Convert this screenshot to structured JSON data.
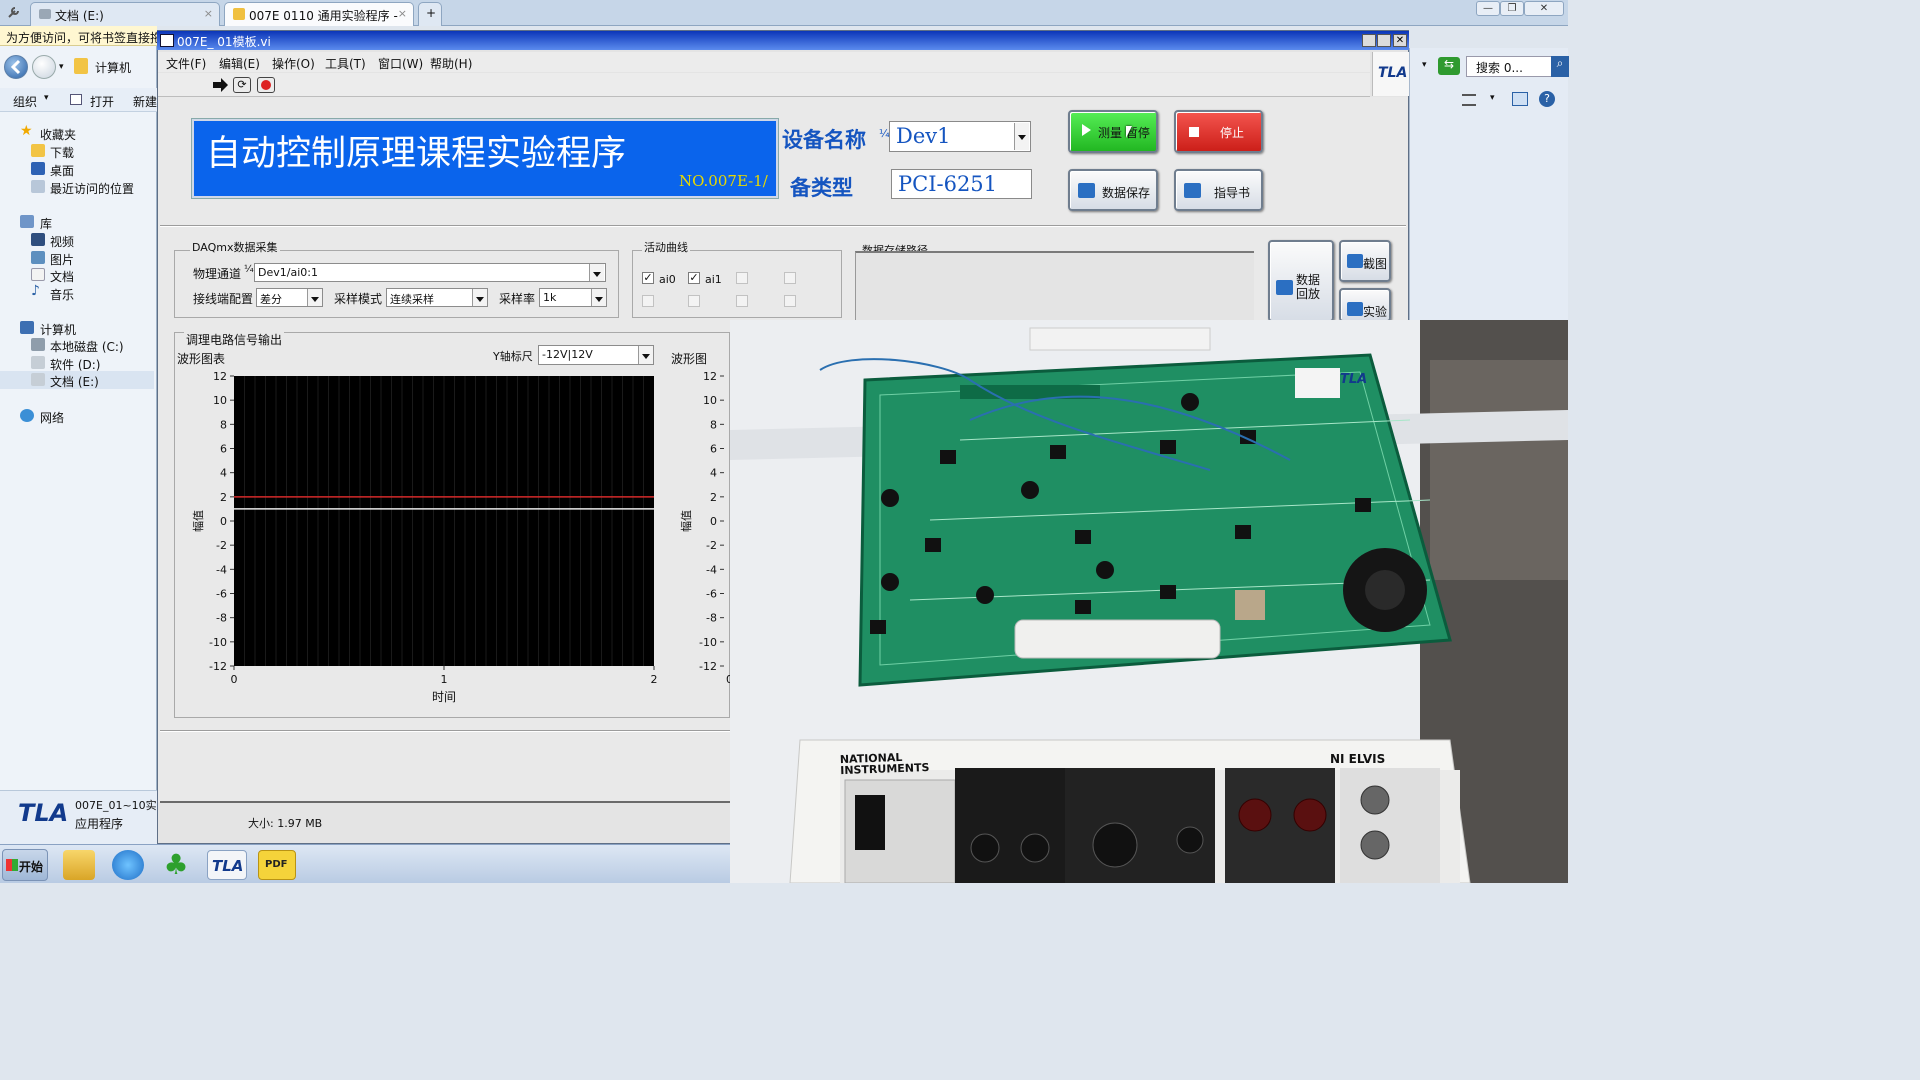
{
  "browser": {
    "tabs": [
      {
        "label": "文档 (E:)",
        "close": "×"
      },
      {
        "label": "007E 0110 通用实验程序 -",
        "close": "×"
      }
    ],
    "new_tab": "+",
    "window_controls": {
      "minimize": "—",
      "restore": "❐",
      "close": "✕"
    },
    "tip": "为方便访问，可将书签直接拖",
    "right_search": "搜索 0..."
  },
  "explorer": {
    "nav_location": "计算机",
    "toolbar": {
      "organize": "组织",
      "open": "打开",
      "new": "新建"
    },
    "tree": {
      "favorites": "收藏夹",
      "downloads": "下载",
      "desktop": "桌面",
      "recent": "最近访问的位置",
      "library": "库",
      "video": "视频",
      "pictures": "图片",
      "documents": "文档",
      "music": "音乐",
      "computer": "计算机",
      "drive_c": "本地磁盘 (C:)",
      "drive_d": "软件 (D:)",
      "drive_e": "文档 (E:)",
      "network": "网络"
    },
    "details": {
      "name": "007E_01~10实",
      "type": "应用程序",
      "size": "大小: 1.97 MB"
    }
  },
  "labview": {
    "window_title": "007E_ 01模板.vi",
    "menu": [
      "文件(F)",
      "编辑(E)",
      "操作(O)",
      "工具(T)",
      "窗口(W)",
      "帮助(H)"
    ],
    "logo": "TLA",
    "banner_title": "自动控制原理课程实验程序",
    "banner_no": "NO.007E-1/",
    "device_name_label": "设备名称",
    "device_name_prefix": "¼",
    "device_name_value": "Dev1",
    "device_type_label": "备类型",
    "device_type_value": "PCI-6251",
    "buttons": {
      "run_pause": "测量 暂停",
      "stop": "停止",
      "save": "数据保存",
      "guide": "指导书",
      "replay": "数据回放",
      "screenshot": "截图",
      "experiment": "实验"
    },
    "daq": {
      "group_label": "DAQmx数据采集",
      "channel_label": "物理通道",
      "channel_prefix": "¼",
      "channel_value": "Dev1/ai0:1",
      "terminal_label": "接线端配置",
      "terminal_value": "差分",
      "mode_label": "采样模式",
      "mode_value": "连续采样",
      "rate_label": "采样率",
      "rate_value": "1k"
    },
    "curves": {
      "group_label": "活动曲线",
      "ai0": "ai0",
      "ai1": "ai1"
    },
    "storage_label": "数据存储路径",
    "signal_group_label": "调理电路信号输出",
    "waveform_label": "波形图表",
    "waveform2_label": "波形图",
    "yaxis_scale_label": "Y轴标尺",
    "yaxis_scale_value": "-12V|12V"
  },
  "chart_data": {
    "type": "line",
    "title": "波形图表",
    "xlabel": "时间",
    "ylabel": "幅值",
    "xlim": [
      0,
      2
    ],
    "ylim": [
      -12,
      12
    ],
    "xticks": [
      "0",
      "1",
      "2"
    ],
    "yticks": [
      "12",
      "10",
      "8",
      "6",
      "4",
      "2",
      "0",
      "-2",
      "-4",
      "-6",
      "-8",
      "-10",
      "-12"
    ],
    "series": [
      {
        "color": "#d42a2a",
        "x": [
          0,
          2
        ],
        "y": [
          2.0,
          2.0
        ]
      },
      {
        "color": "#e8e8e8",
        "x": [
          0,
          2
        ],
        "y": [
          1.0,
          1.0
        ]
      }
    ],
    "background": "#000000",
    "grid": true
  },
  "chart2": {
    "ylabel": "幅值",
    "yticks": [
      "12",
      "10",
      "8",
      "6",
      "4",
      "2",
      "0",
      "-2",
      "-4",
      "-6",
      "-8",
      "-10",
      "-12"
    ],
    "x_first_tick": "0"
  },
  "video_overlay": {
    "brand": "NATIONAL INSTRUMENTS",
    "model": "NI ELVIS",
    "board_logo": "TLA"
  },
  "statusbar": {
    "size": "大小: 1.97 MB"
  },
  "taskbar": {
    "start": "开始",
    "tla": "TLA",
    "pdf": "PDF"
  },
  "colors": {
    "banner": "#0a64ec",
    "accent_text": "#1555c0",
    "run_button": "#2fd12f",
    "stop_button": "#e4312b"
  }
}
